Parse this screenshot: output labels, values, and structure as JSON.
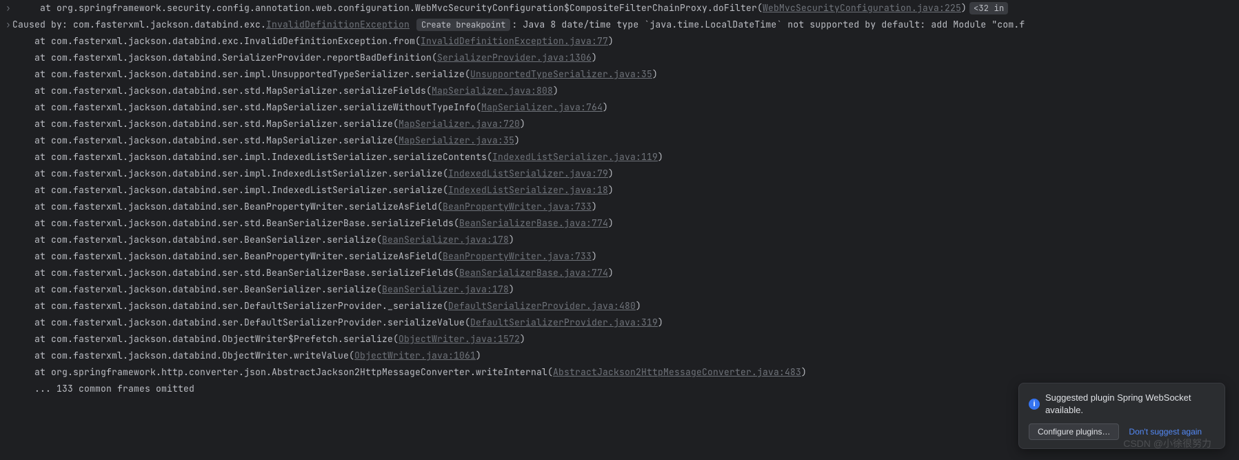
{
  "first_line": {
    "indent": "     ",
    "at": "at ",
    "method": "org.springframework.security.config.annotation.web.configuration.WebMvcSecurityConfiguration$CompositeFilterChainProxy.doFilter",
    "open": "(",
    "link": "WebMvcSecurityConfiguration.java:225",
    "close": ")",
    "tag": "<32 in"
  },
  "caused_by": {
    "prefix": "Caused by: ",
    "pkg": "com.fasterxml.jackson.databind.exc.",
    "ex_link": "InvalidDefinitionException",
    "breakpoint_label": "Create breakpoint",
    "msg": ": Java 8 date/time type `java.time.LocalDateTime` not supported by default: add Module \"com.f"
  },
  "frames": [
    {
      "method": "com.fasterxml.jackson.databind.exc.InvalidDefinitionException.from",
      "link": "InvalidDefinitionException.java:77"
    },
    {
      "method": "com.fasterxml.jackson.databind.SerializerProvider.reportBadDefinition",
      "link": "SerializerProvider.java:1306"
    },
    {
      "method": "com.fasterxml.jackson.databind.ser.impl.UnsupportedTypeSerializer.serialize",
      "link": "UnsupportedTypeSerializer.java:35"
    },
    {
      "method": "com.fasterxml.jackson.databind.ser.std.MapSerializer.serializeFields",
      "link": "MapSerializer.java:808"
    },
    {
      "method": "com.fasterxml.jackson.databind.ser.std.MapSerializer.serializeWithoutTypeInfo",
      "link": "MapSerializer.java:764"
    },
    {
      "method": "com.fasterxml.jackson.databind.ser.std.MapSerializer.serialize",
      "link": "MapSerializer.java:720"
    },
    {
      "method": "com.fasterxml.jackson.databind.ser.std.MapSerializer.serialize",
      "link": "MapSerializer.java:35"
    },
    {
      "method": "com.fasterxml.jackson.databind.ser.impl.IndexedListSerializer.serializeContents",
      "link": "IndexedListSerializer.java:119"
    },
    {
      "method": "com.fasterxml.jackson.databind.ser.impl.IndexedListSerializer.serialize",
      "link": "IndexedListSerializer.java:79"
    },
    {
      "method": "com.fasterxml.jackson.databind.ser.impl.IndexedListSerializer.serialize",
      "link": "IndexedListSerializer.java:18"
    },
    {
      "method": "com.fasterxml.jackson.databind.ser.BeanPropertyWriter.serializeAsField",
      "link": "BeanPropertyWriter.java:733"
    },
    {
      "method": "com.fasterxml.jackson.databind.ser.std.BeanSerializerBase.serializeFields",
      "link": "BeanSerializerBase.java:774"
    },
    {
      "method": "com.fasterxml.jackson.databind.ser.BeanSerializer.serialize",
      "link": "BeanSerializer.java:178"
    },
    {
      "method": "com.fasterxml.jackson.databind.ser.BeanPropertyWriter.serializeAsField",
      "link": "BeanPropertyWriter.java:733"
    },
    {
      "method": "com.fasterxml.jackson.databind.ser.std.BeanSerializerBase.serializeFields",
      "link": "BeanSerializerBase.java:774"
    },
    {
      "method": "com.fasterxml.jackson.databind.ser.BeanSerializer.serialize",
      "link": "BeanSerializer.java:178"
    },
    {
      "method": "com.fasterxml.jackson.databind.ser.DefaultSerializerProvider._serialize",
      "link": "DefaultSerializerProvider.java:480"
    },
    {
      "method": "com.fasterxml.jackson.databind.ser.DefaultSerializerProvider.serializeValue",
      "link": "DefaultSerializerProvider.java:319"
    },
    {
      "method": "com.fasterxml.jackson.databind.ObjectWriter$Prefetch.serialize",
      "link": "ObjectWriter.java:1572"
    },
    {
      "method": "com.fasterxml.jackson.databind.ObjectWriter.writeValue",
      "link": "ObjectWriter.java:1061"
    },
    {
      "method": "org.springframework.http.converter.json.AbstractJackson2HttpMessageConverter.writeInternal",
      "link": "AbstractJackson2HttpMessageConverter.java:483"
    }
  ],
  "omitted": "    ... 133 common frames omitted",
  "at_prefix": "    at ",
  "open_paren": "(",
  "close_paren": ")",
  "notif": {
    "title": "Suggested plugin Spring WebSocket available.",
    "configure": "Configure plugins…",
    "dont": "Don't suggest again"
  },
  "watermark": "CSDN @小徐很努力"
}
